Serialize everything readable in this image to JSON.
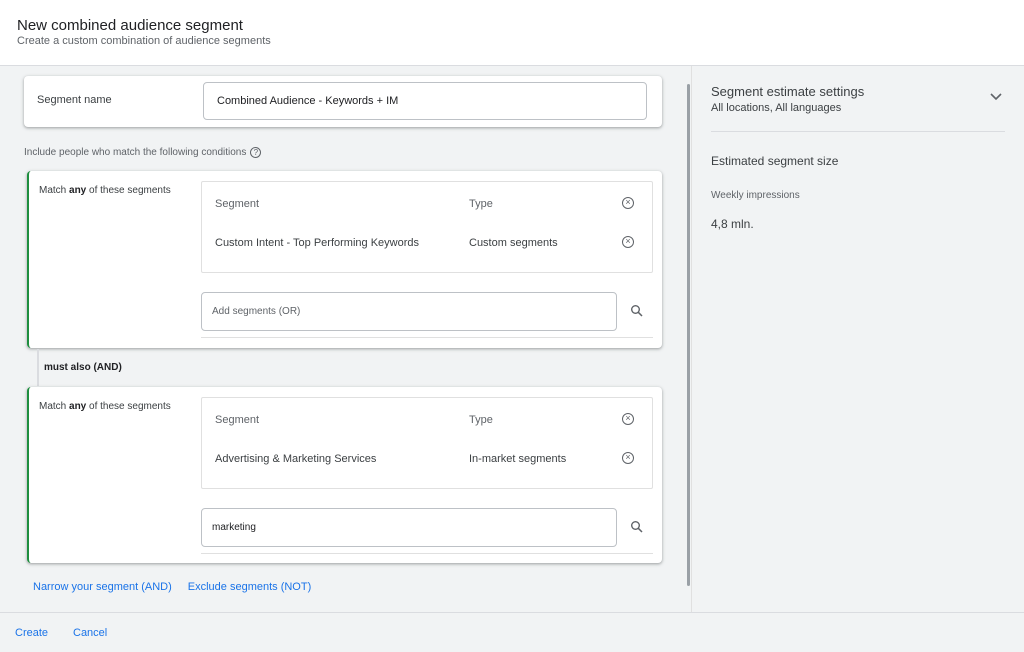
{
  "header": {
    "title": "New combined audience segment",
    "subtitle": "Create a custom combination of audience segments"
  },
  "segment_name": {
    "label": "Segment name",
    "value": "Combined Audience - Keywords + IM"
  },
  "conditions_label": "Include people who match the following conditions",
  "groups": [
    {
      "match_prefix": "Match ",
      "match_bold": "any",
      "match_suffix": " of these segments",
      "table_headers": [
        "Segment",
        "Type"
      ],
      "rows": [
        {
          "segment": "Custom Intent - Top Performing Keywords",
          "type": "Custom segments"
        }
      ],
      "input_placeholder": "Add segments (OR)",
      "input_value": ""
    },
    {
      "match_prefix": "Match ",
      "match_bold": "any",
      "match_suffix": " of these segments",
      "table_headers": [
        "Segment",
        "Type"
      ],
      "rows": [
        {
          "segment": "Advertising & Marketing Services",
          "type": "In-market segments"
        }
      ],
      "input_placeholder": "",
      "input_value": "marketing"
    }
  ],
  "and_label": "must also (AND)",
  "links": {
    "narrow": "Narrow your segment (AND)",
    "exclude": "Exclude segments (NOT)"
  },
  "footer": {
    "create": "Create",
    "cancel": "Cancel"
  },
  "side": {
    "settings_title": "Segment estimate settings",
    "settings_sub": "All locations, All languages",
    "size_title": "Estimated segment size",
    "weekly_label": "Weekly impressions",
    "weekly_value": "4,8 mln."
  },
  "icons": {
    "remove": "close-circle-icon",
    "search": "search-icon",
    "help": "help-circle-icon",
    "expand": "chevron-down-icon"
  },
  "colors": {
    "accent": "#1a73e8",
    "group_border": "#1e8e3e"
  }
}
